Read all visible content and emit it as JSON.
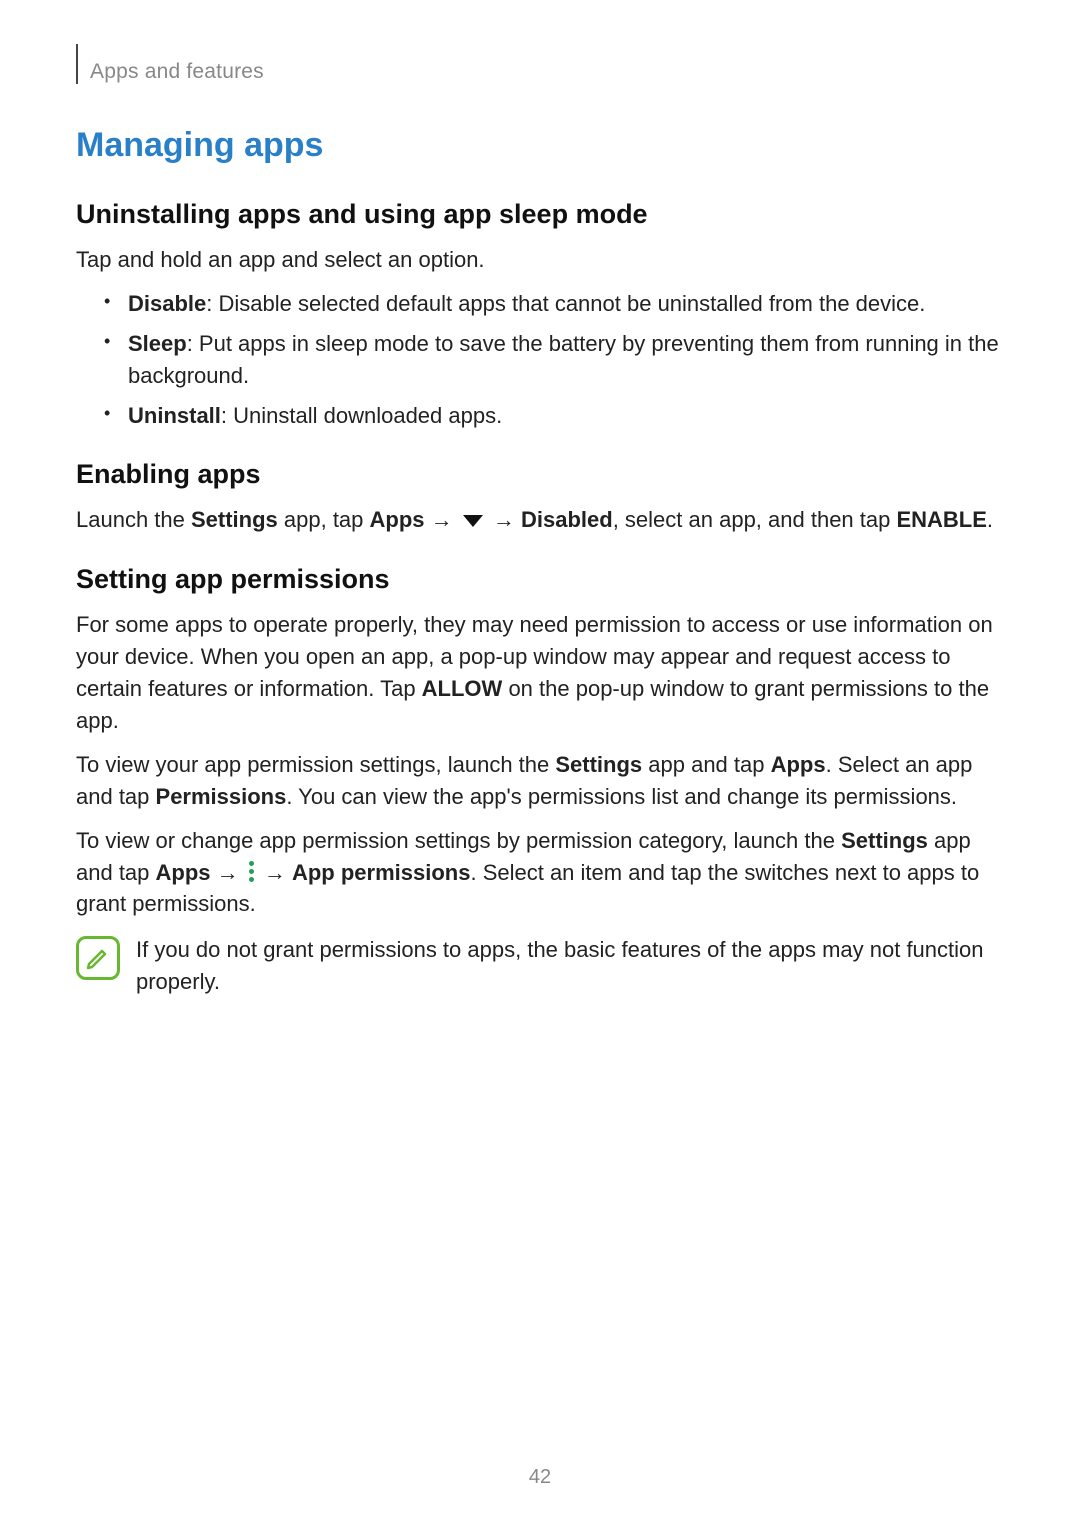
{
  "header": {
    "breadcrumb": "Apps and features"
  },
  "title": "Managing apps",
  "section1": {
    "heading": "Uninstalling apps and using app sleep mode",
    "intro": "Tap and hold an app and select an option.",
    "bullets": [
      {
        "label": "Disable",
        "desc": ": Disable selected default apps that cannot be uninstalled from the device."
      },
      {
        "label": "Sleep",
        "desc": ": Put apps in sleep mode to save the battery by preventing them from running in the background."
      },
      {
        "label": "Uninstall",
        "desc": ": Uninstall downloaded apps."
      }
    ]
  },
  "section2": {
    "heading": "Enabling apps",
    "line": {
      "p1": "Launch the ",
      "settings": "Settings",
      "p2": " app, tap ",
      "apps": "Apps",
      "arrow1": " → ",
      "arrow2": " → ",
      "disabled": "Disabled",
      "p3": ", select an app, and then tap ",
      "enable": "ENABLE",
      "p4": "."
    }
  },
  "section3": {
    "heading": "Setting app permissions",
    "para1": {
      "p1": "For some apps to operate properly, they may need permission to access or use information on your device. When you open an app, a pop-up window may appear and request access to certain features or information. Tap ",
      "allow": "ALLOW",
      "p2": " on the pop-up window to grant permissions to the app."
    },
    "para2": {
      "p1": "To view your app permission settings, launch the ",
      "settings": "Settings",
      "p2": " app and tap ",
      "apps": "Apps",
      "p3": ". Select an app and tap ",
      "permissions": "Permissions",
      "p4": ". You can view the app's permissions list and change its permissions."
    },
    "para3": {
      "p1": "To view or change app permission settings by permission category, launch the ",
      "settings": "Settings",
      "p2": " app and tap ",
      "apps": "Apps",
      "arrow1": " → ",
      "arrow2": " → ",
      "app_perm": "App permissions",
      "p3": ". Select an item and tap the switches next to apps to grant permissions."
    },
    "note": "If you do not grant permissions to apps, the basic features of the apps may not function properly."
  },
  "page_number": "42"
}
